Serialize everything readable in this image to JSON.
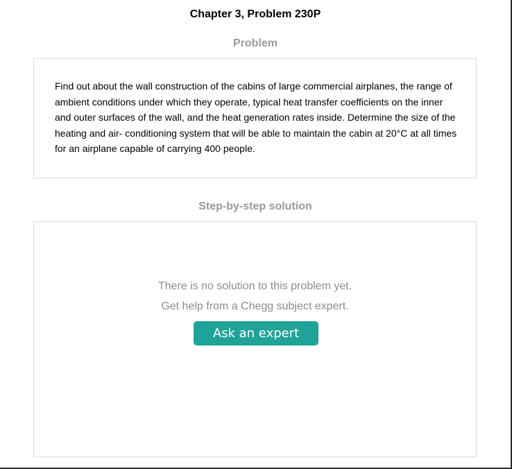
{
  "header": {
    "title": "Chapter 3, Problem 230P"
  },
  "problem": {
    "heading": "Problem",
    "text": "Find out about the wall construction of the cabins of large commercial airplanes, the range of ambient conditions under which they operate, typical heat transfer coefficients on the inner and outer surfaces of the wall, and the heat generation rates inside. Determine the size of the heating and air- conditioning system that will be able to maintain the cabin at 20°C at all times for an airplane capable of carrying 400 people."
  },
  "solution": {
    "heading": "Step-by-step solution",
    "message_line1": "There is no solution to this problem yet.",
    "message_line2": "Get help from a Chegg subject expert.",
    "button_label": "Ask an expert"
  },
  "colors": {
    "button": "#1fa398",
    "heading_gray": "#9a9a9a",
    "message_gray": "#8d8d8d",
    "border": "#dcdcdc"
  }
}
